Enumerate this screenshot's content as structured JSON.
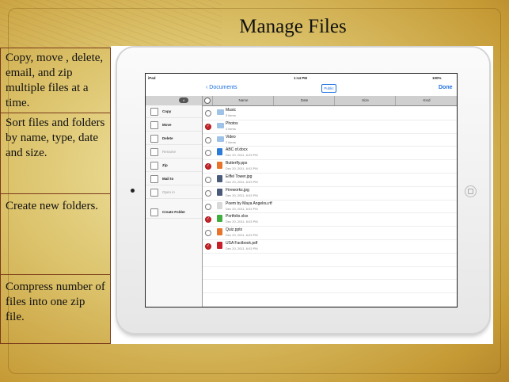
{
  "title": "Manage Files",
  "features": [
    "Copy, move , delete, email, and zip  multiple files at a time.",
    "Sort files and folders by name, type, date and size.",
    "Create new folders.",
    "Compress number of files into one zip file."
  ],
  "device": {
    "status": {
      "carrier": "iPad",
      "time": "1:14 PM",
      "battery": "100%"
    },
    "nav": {
      "back_label": "Documents",
      "public_label": "Public",
      "done_label": "Done"
    },
    "sidebar": {
      "selected_count": "4",
      "actions": [
        {
          "label": "Copy",
          "icon": "copy-icon",
          "enabled": true
        },
        {
          "label": "Move",
          "icon": "move-icon",
          "enabled": true
        },
        {
          "label": "Delete",
          "icon": "trash-icon",
          "enabled": true
        },
        {
          "label": "Rename",
          "icon": "rename-icon",
          "enabled": false
        },
        {
          "label": "Zip",
          "icon": "zip-icon",
          "enabled": true
        },
        {
          "label": "Mail to",
          "icon": "mail-icon",
          "enabled": true
        },
        {
          "label": "Open in",
          "icon": "open-in-icon",
          "enabled": false
        },
        {
          "label": "Create Folder",
          "icon": "folder-icon",
          "enabled": true
        }
      ]
    },
    "columns": [
      "Name",
      "Date",
      "Size",
      "Kind"
    ],
    "files": [
      {
        "name": "Music",
        "detail": "3 items",
        "type": "folder",
        "selected": false
      },
      {
        "name": "Photos",
        "detail": "4 items",
        "type": "folder",
        "selected": true
      },
      {
        "name": "Video",
        "detail": "2 items",
        "type": "folder",
        "selected": false
      },
      {
        "name": "ABC of.docx",
        "detail": "Dec 20, 2011, 6:03 PM",
        "type": "docx",
        "selected": false
      },
      {
        "name": "Butterfly.pps",
        "detail": "Dec 20, 2011, 6:03 PM",
        "type": "pps",
        "selected": true
      },
      {
        "name": "Eiffel Tower.jpg",
        "detail": "Dec 20, 2011, 6:03 PM",
        "type": "jpg",
        "selected": false
      },
      {
        "name": "Fireworks.jpg",
        "detail": "Dec 20, 2011, 6:03 PM",
        "type": "jpg",
        "selected": false
      },
      {
        "name": "Poem by Maya Angelou.rtf",
        "detail": "Dec 20, 2011, 6:03 PM",
        "type": "rtf",
        "selected": false
      },
      {
        "name": "Portfolio.xlsx",
        "detail": "Dec 20, 2011, 6:03 PM",
        "type": "xlsx",
        "selected": true
      },
      {
        "name": "Quiz.pptx",
        "detail": "Dec 20, 2011, 6:03 PM",
        "type": "pptx",
        "selected": false
      },
      {
        "name": "USA Factbook.pdf",
        "detail": "Dec 20, 2011, 6:03 PM",
        "type": "pdf",
        "selected": true
      }
    ],
    "file_colors": {
      "folder": "#9ec3e6",
      "docx": "#2b7bd8",
      "pps": "#e8732a",
      "jpg": "#4a5a7a",
      "rtf": "#d9d9d9",
      "xlsx": "#3fae3f",
      "pptx": "#e8732a",
      "pdf": "#c8202b"
    }
  }
}
